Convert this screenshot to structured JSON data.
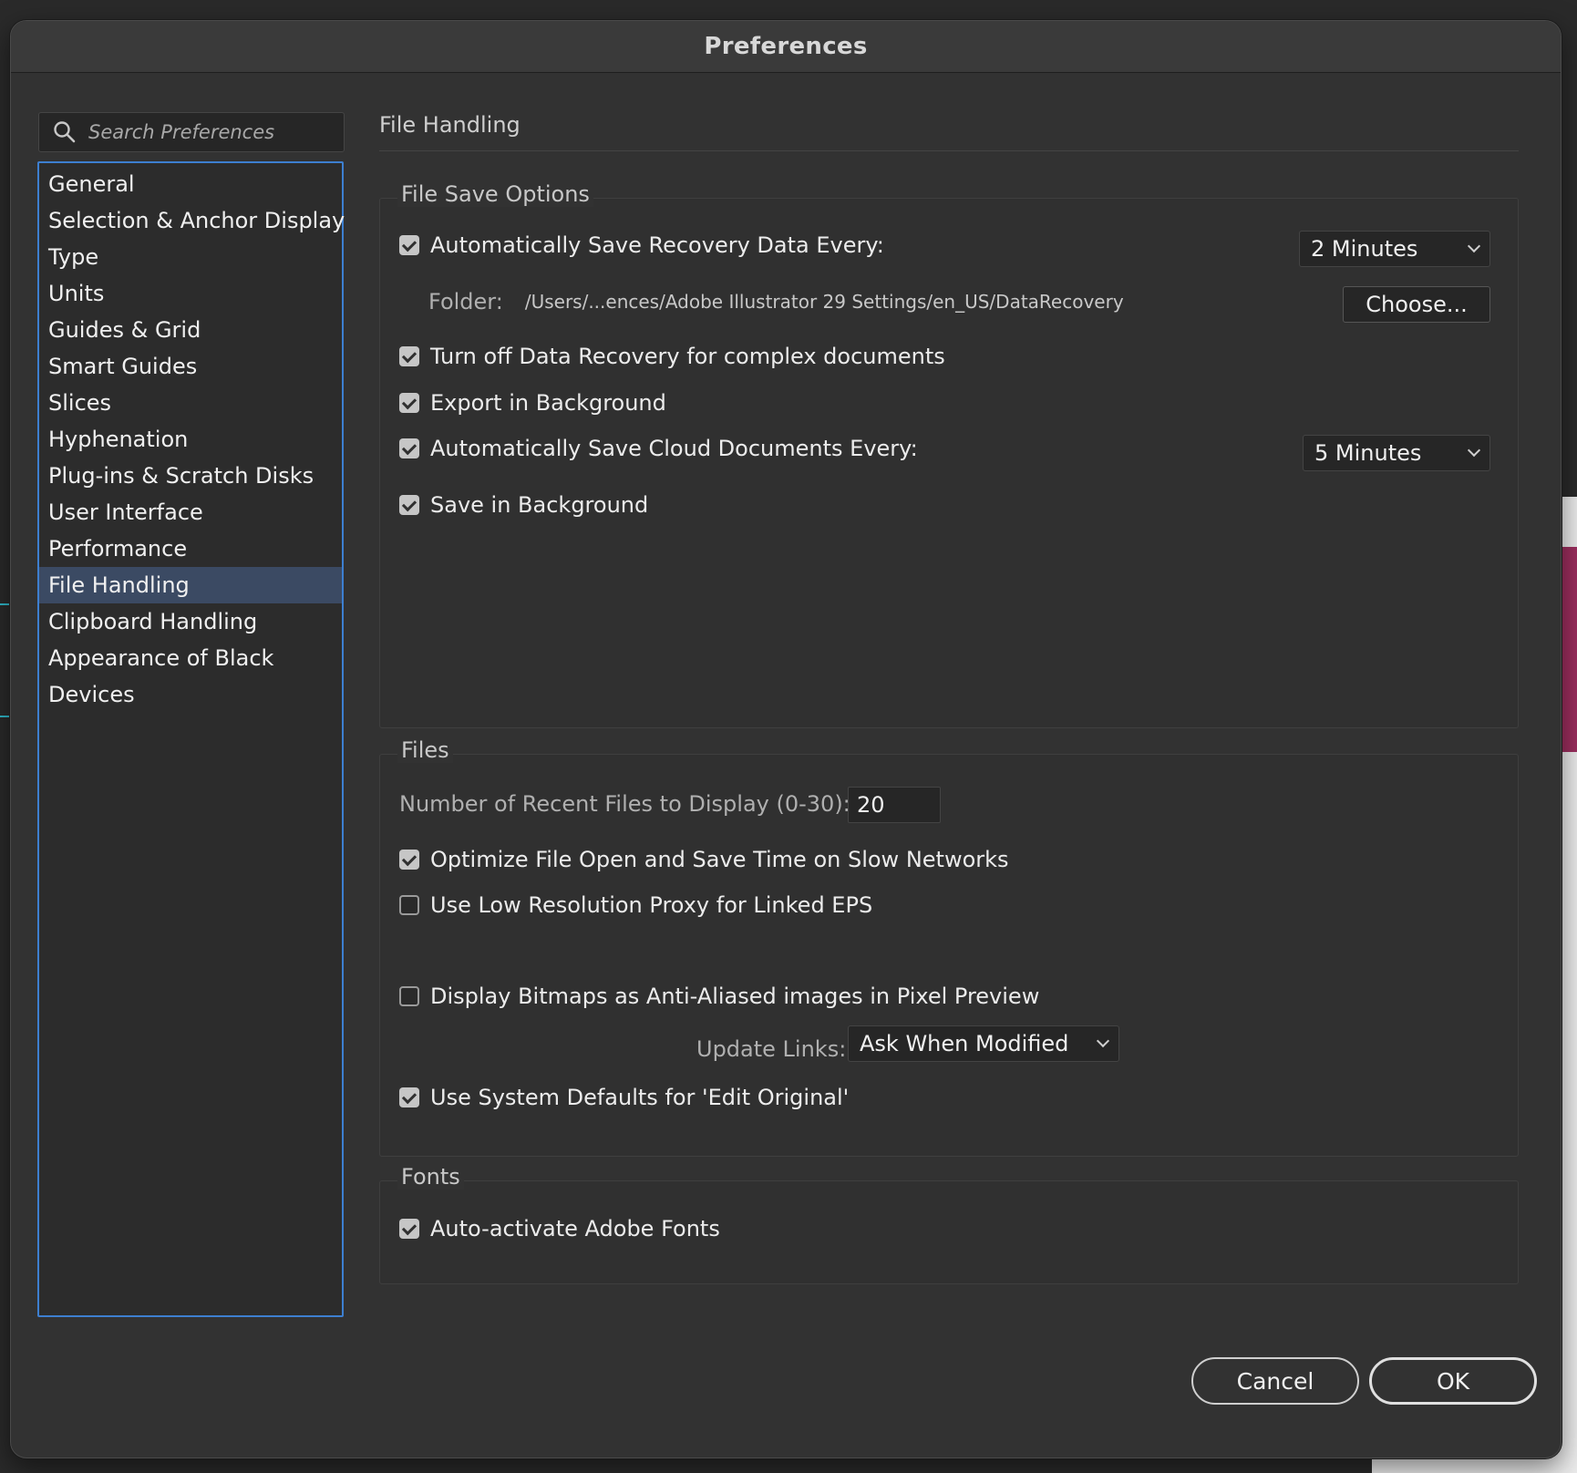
{
  "dialog": {
    "title": "Preferences"
  },
  "search": {
    "placeholder": "Search Preferences"
  },
  "categories": [
    "General",
    "Selection & Anchor Display",
    "Type",
    "Units",
    "Guides & Grid",
    "Smart Guides",
    "Slices",
    "Hyphenation",
    "Plug-ins & Scratch Disks",
    "User Interface",
    "Performance",
    "File Handling",
    "Clipboard Handling",
    "Appearance of Black",
    "Devices"
  ],
  "selected_category": "File Handling",
  "panel": {
    "title": "File Handling",
    "file_save_options": {
      "legend": "File Save Options",
      "auto_save_recovery": {
        "label": "Automatically Save Recovery Data Every:",
        "checked": true
      },
      "recovery_interval": "2 Minutes",
      "folder_label": "Folder:",
      "folder_path": "/Users/...ences/Adobe Illustrator 29 Settings/en_US/DataRecovery",
      "choose_label": "Choose...",
      "turn_off_recovery": {
        "label": "Turn off Data Recovery for complex documents",
        "checked": true
      },
      "export_background": {
        "label": "Export in Background",
        "checked": true
      },
      "auto_save_cloud": {
        "label": "Automatically Save Cloud Documents Every:",
        "checked": true
      },
      "cloud_interval": "5 Minutes",
      "save_background": {
        "label": "Save in Background",
        "checked": true
      }
    },
    "files": {
      "legend": "Files",
      "recent_files_label": "Number of Recent Files to Display (0-30):",
      "recent_files_value": "20",
      "optimize_slow_networks": {
        "label": "Optimize File Open and Save Time on Slow Networks",
        "checked": true
      },
      "low_res_proxy": {
        "label": "Use Low Resolution Proxy for Linked EPS",
        "checked": false
      },
      "anti_aliased_bitmaps": {
        "label": "Display Bitmaps as Anti-Aliased images in Pixel Preview",
        "checked": false
      },
      "update_links_label": "Update Links:",
      "update_links_value": "Ask When Modified",
      "system_defaults_edit": {
        "label": "Use System Defaults for 'Edit Original'",
        "checked": true
      }
    },
    "fonts": {
      "legend": "Fonts",
      "auto_activate": {
        "label": "Auto-activate Adobe Fonts",
        "checked": true
      }
    }
  },
  "footer": {
    "cancel_label": "Cancel",
    "ok_label": "OK"
  },
  "colors": {
    "selection": "#3b4a63",
    "list_border": "#3d7fd0",
    "dialog_bg": "#323232"
  }
}
